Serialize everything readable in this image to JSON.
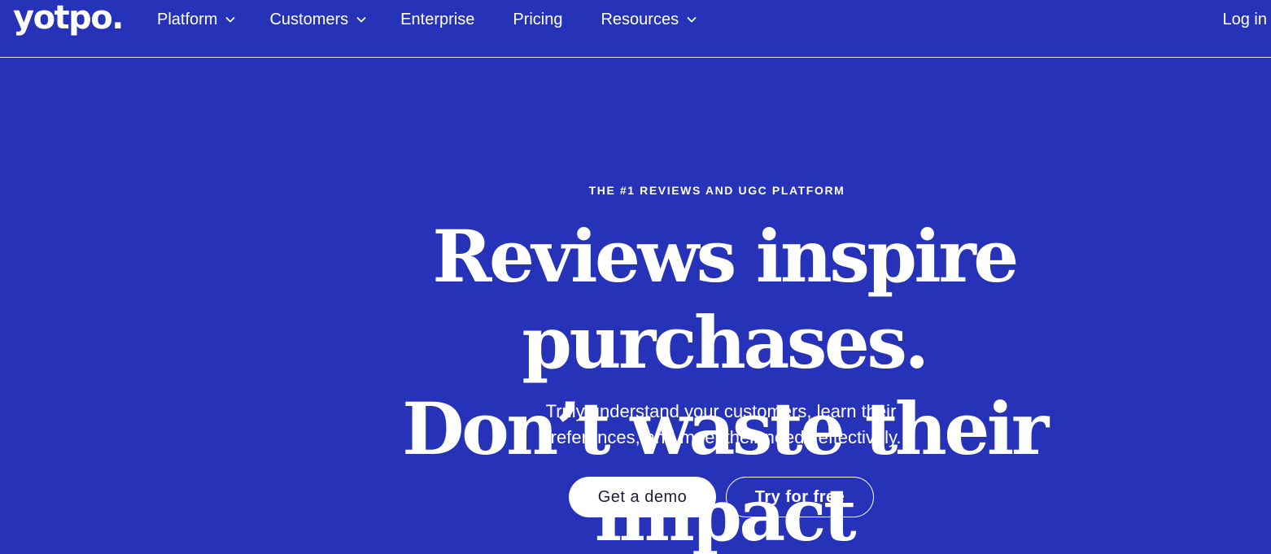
{
  "header": {
    "logo": "yotpo.",
    "nav": [
      {
        "label": "Platform",
        "has_dropdown": true
      },
      {
        "label": "Customers",
        "has_dropdown": true
      },
      {
        "label": "Enterprise",
        "has_dropdown": false
      },
      {
        "label": "Pricing",
        "has_dropdown": false
      },
      {
        "label": "Resources",
        "has_dropdown": true
      }
    ],
    "login_label": "Log in"
  },
  "hero": {
    "eyebrow": "THE #1 REVIEWS AND UGC PLATFORM",
    "headline_line1": "Reviews inspire purchases.",
    "headline_line2": "Don’t waste their impact",
    "subtitle_line1": "Truly understand your customers, learn their",
    "subtitle_line2": "preferences, and meet their needs effectively.",
    "primary_cta": "Get a demo",
    "secondary_cta": "Try for free"
  },
  "icons": {
    "dropdown": "chevron-down-icon"
  },
  "colors": {
    "background": "#2633b9",
    "text": "#ffffff",
    "primary_button_bg": "#ffffff",
    "primary_button_text": "#1d1d3b"
  }
}
